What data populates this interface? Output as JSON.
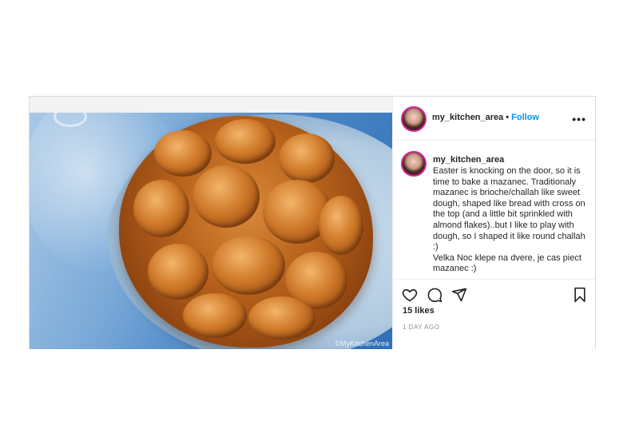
{
  "post": {
    "username": "my_kitchen_area",
    "follow_label": "Follow",
    "separator": "•",
    "more_label": "•••",
    "watermark": "©MyKitchenArea",
    "caption_username": "my_kitchen_area",
    "caption_text": "Easter is knocking on the door, so it is time to bake a mazanec. Traditionaly mazanec is brioche/challah like sweet dough, shaped like bread with cross on the top (and a little bit sprinkled with almond flakes)..but I like to play with dough, so I shaped it like round challah :)\nVelka Noc klepe na dvere, je cas piect mazanec :)",
    "likes": "15 likes",
    "timestamp": "1 DAY AGO"
  },
  "icons": {
    "like": "heart-icon",
    "comment": "comment-icon",
    "share": "paper-plane-icon",
    "save": "bookmark-icon"
  },
  "colors": {
    "follow": "#0095f6",
    "avatar_ring": "#d6249f",
    "muted": "#8e8e8e",
    "text": "#262626"
  }
}
